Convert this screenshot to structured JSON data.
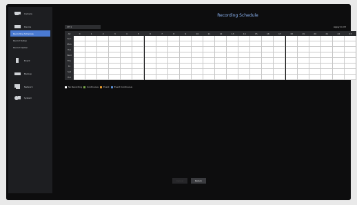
{
  "title": "Recording Schedule",
  "sidebar": {
    "items": [
      {
        "label": "Camera",
        "icon": "camera-icon"
      },
      {
        "label": "Device",
        "icon": "device-icon"
      },
      {
        "label": "Recording Schedule",
        "active": true
      },
      {
        "label": "Record Setup"
      },
      {
        "label": "Record Option"
      },
      {
        "label": "Event",
        "icon": "event-icon"
      },
      {
        "label": "Backup",
        "icon": "backup-icon"
      },
      {
        "label": "Network",
        "icon": "network-icon"
      },
      {
        "label": "System",
        "icon": "system-icon"
      }
    ]
  },
  "channel_select": {
    "value": "CH 1"
  },
  "apply_button": {
    "label": "Apply to CH"
  },
  "grid": {
    "corner_label": "All",
    "hours": [
      "0",
      "1",
      "2",
      "3",
      "4",
      "5",
      "6",
      "7",
      "8",
      "9",
      "10",
      "11",
      "12",
      "13",
      "14",
      "15",
      "16",
      "17",
      "18",
      "19",
      "20",
      "21",
      "22",
      "23"
    ],
    "days": [
      "Sun",
      "Mon",
      "Tue",
      "Wed",
      "Thu",
      "Fri",
      "Sat",
      "Hol"
    ]
  },
  "legend": [
    {
      "label": "No Recording",
      "color": "#ffffff"
    },
    {
      "label": "Continuous",
      "color": "#7aa84b"
    },
    {
      "label": "Event",
      "color": "#e89a2c"
    },
    {
      "label": "Event Continuous",
      "color": "#5a8fd6"
    }
  ],
  "buttons": {
    "cancel": "Cancel",
    "return": "Return"
  }
}
